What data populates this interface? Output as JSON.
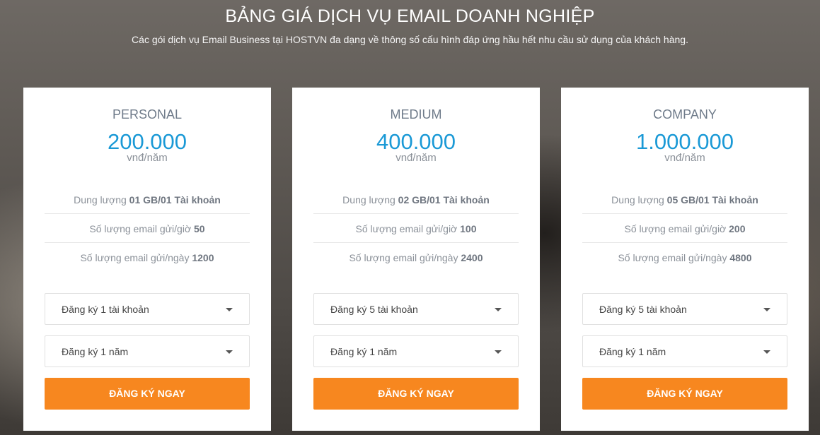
{
  "header": {
    "title": "BẢNG GIÁ DỊCH VỤ EMAIL DOANH NGHIỆP",
    "subtitle": "Các gói dịch vụ Email Business tại HOSTVN đa dạng về thông số cấu hình đáp ứng hầu hết nhu cầu sử dụng của khách hàng."
  },
  "colors": {
    "accent": "#f7871f",
    "price": "#1a99d6",
    "plan_name": "#6f7b8a"
  },
  "plans": [
    {
      "name": "PERSONAL",
      "price": "200.000",
      "unit": "vnđ/năm",
      "features": [
        {
          "label": "Dung lượng ",
          "value": "01 GB/01 Tài khoản"
        },
        {
          "label": "Số lượng email gửi/giờ ",
          "value": "50"
        },
        {
          "label": "Số lượng email gửi/ngày ",
          "value": "1200"
        }
      ],
      "account_select": "Đăng ký 1 tài khoản",
      "period_select": "Đăng ký 1 năm",
      "button": "ĐĂNG KÝ NGAY"
    },
    {
      "name": "MEDIUM",
      "price": "400.000",
      "unit": "vnđ/năm",
      "features": [
        {
          "label": "Dung lượng ",
          "value": "02 GB/01 Tài khoản"
        },
        {
          "label": "Số lượng email gửi/giờ ",
          "value": "100"
        },
        {
          "label": "Số lượng email gửi/ngày ",
          "value": "2400"
        }
      ],
      "account_select": "Đăng ký 5 tài khoản",
      "period_select": "Đăng ký 1 năm",
      "button": "ĐĂNG KÝ NGAY"
    },
    {
      "name": "COMPANY",
      "price": "1.000.000",
      "unit": "vnđ/năm",
      "features": [
        {
          "label": "Dung lượng ",
          "value": "05 GB/01 Tài khoản"
        },
        {
          "label": "Số lượng email gửi/giờ ",
          "value": "200"
        },
        {
          "label": "Số lượng email gửi/ngày ",
          "value": "4800"
        }
      ],
      "account_select": "Đăng ký 5 tài khoản",
      "period_select": "Đăng ký 1 năm",
      "button": "ĐĂNG KÝ NGAY"
    }
  ]
}
